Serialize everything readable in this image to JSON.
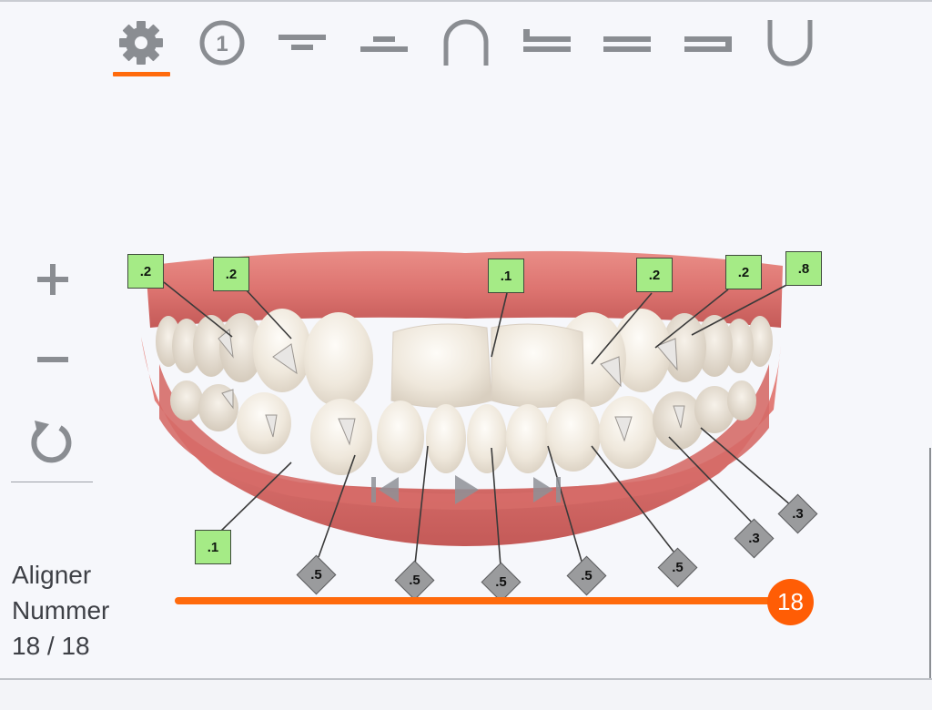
{
  "toolbar": {
    "items": [
      {
        "name": "settings-gear-icon",
        "active": true
      },
      {
        "name": "step-one-icon",
        "label": "1"
      },
      {
        "name": "upper-overbite-icon"
      },
      {
        "name": "lower-overbite-icon"
      },
      {
        "name": "upper-arch-icon"
      },
      {
        "name": "upper-overlap-icon"
      },
      {
        "name": "equal-bite-icon"
      },
      {
        "name": "lower-overlap-icon"
      },
      {
        "name": "lower-arch-icon"
      }
    ],
    "accent": "#ff6a0c",
    "icon_color": "#8a8d92"
  },
  "zoom": {
    "zoom_in_icon": "plus-icon",
    "zoom_out_icon": "minus-icon",
    "reset_icon": "rotate-reset-icon"
  },
  "upper_tags": [
    ".2",
    ".2",
    ".1",
    ".2",
    ".2",
    ".8"
  ],
  "lower_tags": {
    "green": [
      ".1"
    ],
    "gray": [
      ".5",
      ".5",
      ".5",
      ".5",
      ".5",
      ".3",
      ".3"
    ]
  },
  "playback": {
    "prev_icon": "skip-back-icon",
    "play_icon": "play-icon",
    "next_icon": "skip-forward-icon"
  },
  "aligner": {
    "line1": "Aligner",
    "line2": "Nummer",
    "line3": "18 / 18",
    "current": "18",
    "progress": 1.0
  },
  "colors": {
    "tag_green": "#a5eb86",
    "tag_gray": "#9a9b9d",
    "gum": "#e07a76",
    "tooth": "#f1ece3"
  }
}
